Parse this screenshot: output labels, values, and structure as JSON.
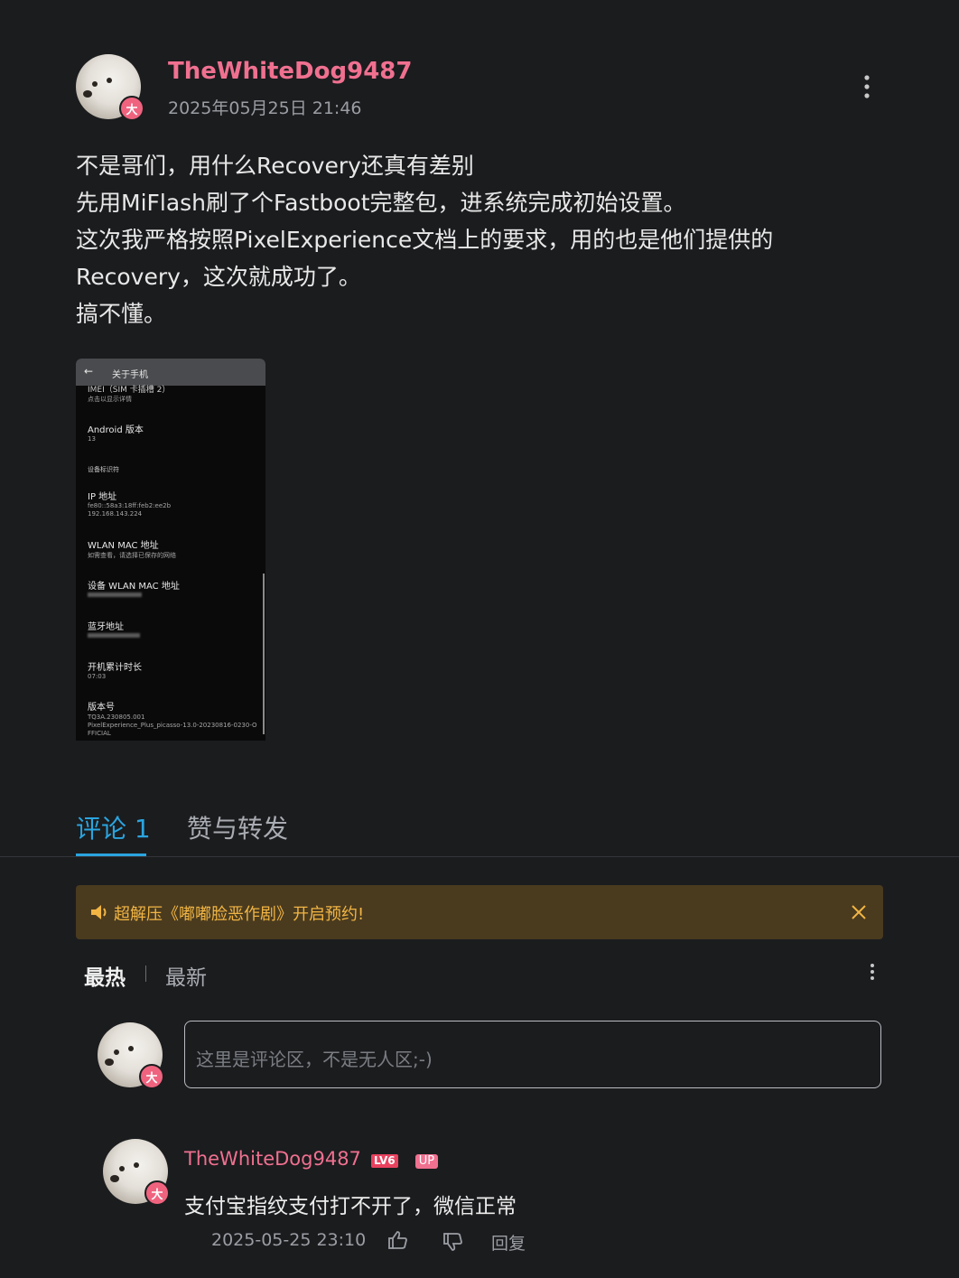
{
  "post": {
    "author": "TheWhiteDog9487",
    "author_badge": "大",
    "timestamp": "2025年05月25日 21:46",
    "lines": [
      "不是哥们，用什么Recovery还真有差别",
      "先用MiFlash刷了个Fastboot完整包，进系统完成初始设置。",
      "这次我严格按照PixelExperience文档上的要求，用的也是他们提供的",
      "Recovery，这次就成功了。",
      "搞不懂。"
    ]
  },
  "screenshot": {
    "header_title": "关于手机",
    "imei_cut": "IMEI（SIM 卡插槽 2）",
    "imei_sub": "点击以显示详情",
    "android_label": "Android 版本",
    "android_value": "13",
    "section": "设备标识符",
    "ip_label": "IP 地址",
    "ip_v6": "fe80::58a3:18ff:feb2:ee2b",
    "ip_v4": "192.168.143.224",
    "wlan_label": "WLAN MAC 地址",
    "wlan_sub": "如需查看，请选择已保存的网络",
    "device_wlan_label": "设备 WLAN MAC 地址",
    "bt_label": "蓝牙地址",
    "uptime_label": "开机累计时长",
    "uptime_value": "07:03",
    "build_label": "版本号",
    "build_line1": "TQ3A.230805.001",
    "build_line2": "PixelExperience_Plus_picasso-13.0-20230816-0230-O",
    "build_line3": "FFICIAL"
  },
  "tabs": {
    "comments": "评论 1",
    "likes": "赞与转发"
  },
  "notice": {
    "text": "超解压《嘟嘟脸恶作剧》开启预约!"
  },
  "sort": {
    "hot": "最热",
    "new": "最新"
  },
  "comment_input": {
    "placeholder": "这里是评论区，不是无人区;-)"
  },
  "comment": {
    "author": "TheWhiteDog9487",
    "level": "LV6",
    "up_tag": "UP",
    "badge": "大",
    "text": "支付宝指纹支付打不开了，微信正常",
    "time": "2025-05-25 23:10",
    "reply": "回复"
  },
  "colors": {
    "background": "#1b1c1e",
    "username": "#f07090",
    "accent_tab": "#2aa5e0",
    "notice_bg": "#4a3b1f",
    "notice_text": "#f2b544"
  }
}
